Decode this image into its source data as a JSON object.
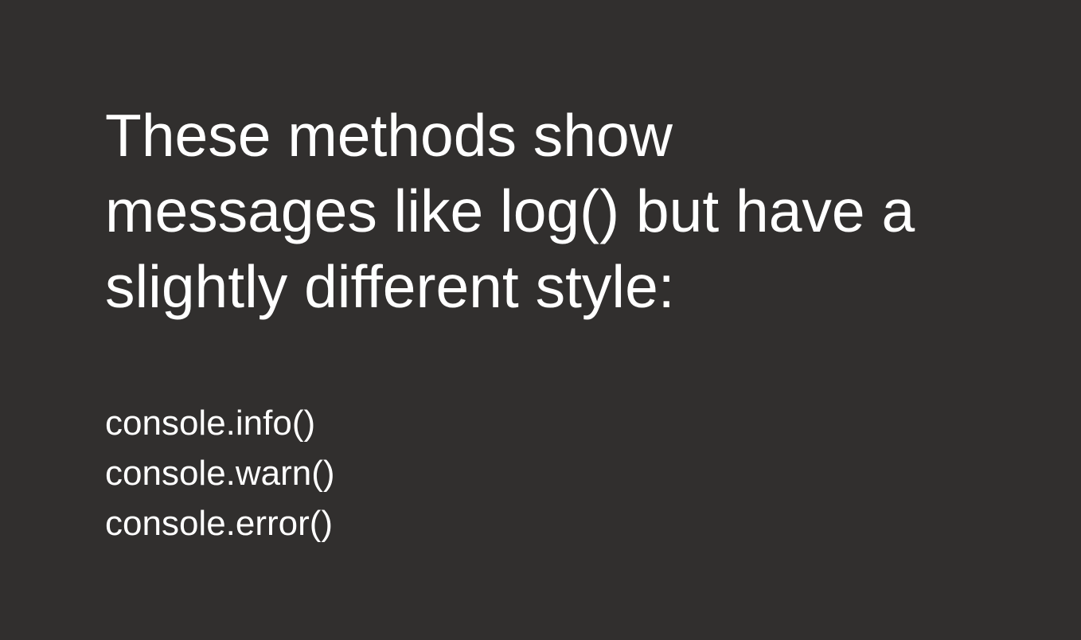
{
  "slide": {
    "heading_lines": [
      "These methods show",
      "messages like log() but have a",
      "slightly different style:"
    ],
    "methods": [
      "console.info()",
      "console.warn()",
      "console.error()"
    ]
  },
  "colors": {
    "background": "#312f2e",
    "text": "#ffffff"
  }
}
